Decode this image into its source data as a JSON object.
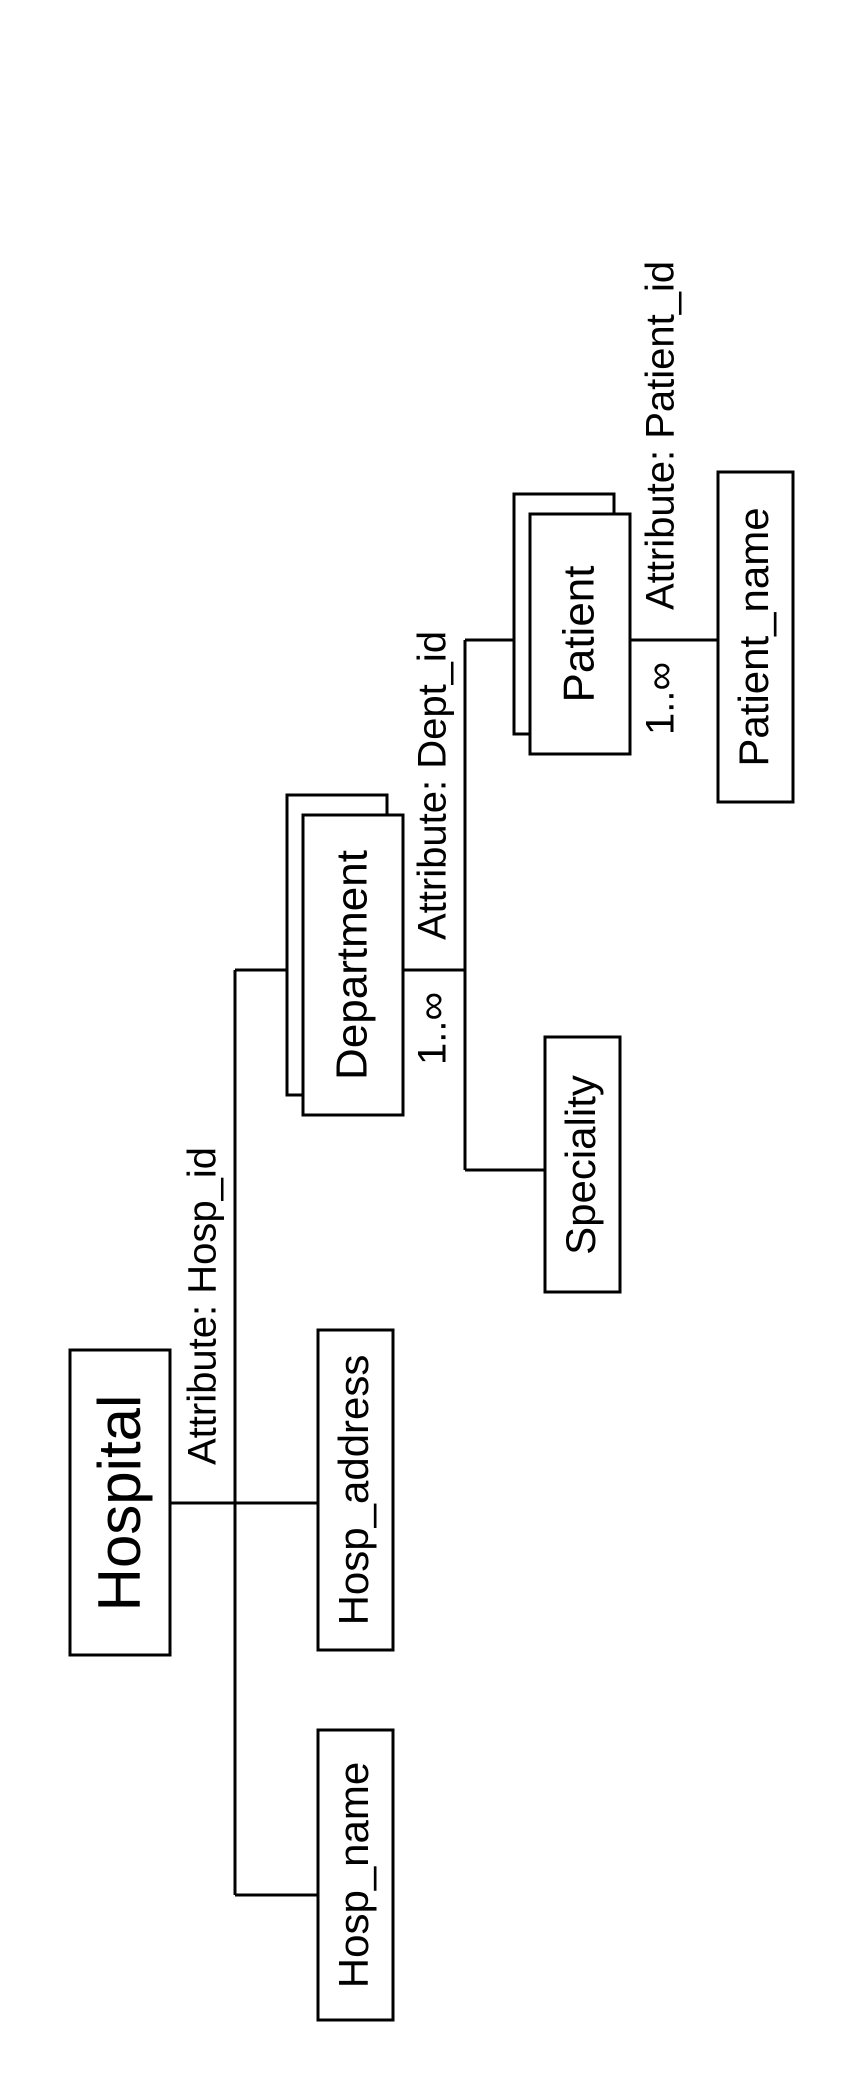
{
  "diagram": {
    "root": {
      "label": "Hospital",
      "attribute": "Attribute: Hosp_id",
      "children": {
        "hosp_name": "Hosp_name",
        "hosp_address": "Hosp_address",
        "department": {
          "label": "Department",
          "cardinality": "1..∞",
          "attribute": "Attribute: Dept_id",
          "children": {
            "speciality": "Speciality",
            "patient": {
              "label": "Patient",
              "cardinality": "1..∞",
              "attribute": "Attribute: Patient_id",
              "children": {
                "patient_name": "Patient_name"
              }
            }
          }
        }
      }
    }
  }
}
